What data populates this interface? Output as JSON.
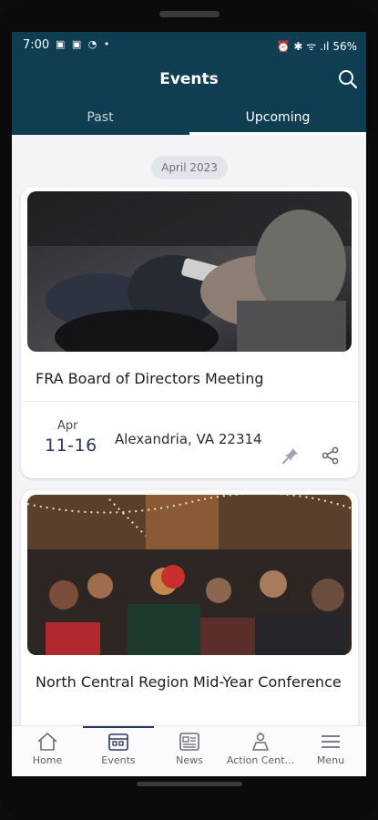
{
  "status_bar": {
    "time": "7:00",
    "left_icons": "▣ ▣ ◔ •",
    "right_icons": "⏰ ✱ ᯤ .ıl 56%"
  },
  "header": {
    "title": "Events"
  },
  "tabs": [
    {
      "label": "Past"
    },
    {
      "label": "Upcoming"
    }
  ],
  "month_chip": "April 2023",
  "events": [
    {
      "title": "FRA Board of Directors Meeting",
      "month": "Apr",
      "days": "11-16",
      "location": "Alexandria, VA 22314"
    },
    {
      "title": "North Central Region Mid-Year Conference"
    }
  ],
  "nav": [
    {
      "label": "Home",
      "icon": "home-icon"
    },
    {
      "label": "Events",
      "icon": "calendar-icon"
    },
    {
      "label": "News",
      "icon": "news-icon"
    },
    {
      "label": "Action Cent...",
      "icon": "megaphone-icon"
    },
    {
      "label": "Menu",
      "icon": "menu-icon"
    }
  ],
  "colors": {
    "header_bg": "#0f3e52",
    "accent": "#2a3a63"
  }
}
